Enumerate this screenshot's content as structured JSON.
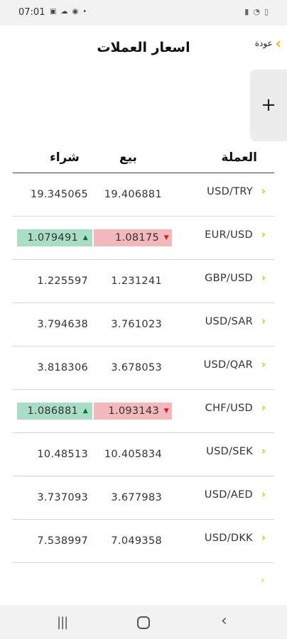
{
  "status_bar": {
    "time": "07:01",
    "left_icons": [
      "gallery-icon",
      "cloud-icon",
      "messenger-icon",
      "dot-icon"
    ],
    "right_icons": [
      "battery-saver-icon",
      "wifi-icon",
      "battery-icon"
    ]
  },
  "header": {
    "title": "اسعار العملات",
    "back_label": "عودة",
    "back_icon": "chevron-left-icon",
    "add_label": "+"
  },
  "table": {
    "columns": {
      "currency": "العملة",
      "sell": "بيع",
      "buy": "شراء"
    },
    "rows": [
      {
        "pair": "USD/TRY",
        "sell": "19.406881",
        "buy": "19.345065",
        "sell_trend": "",
        "buy_trend": ""
      },
      {
        "pair": "EUR/USD",
        "sell": "1.08175",
        "buy": "1.079491",
        "sell_trend": "down",
        "buy_trend": "up"
      },
      {
        "pair": "GBP/USD",
        "sell": "1.231241",
        "buy": "1.225597",
        "sell_trend": "",
        "buy_trend": ""
      },
      {
        "pair": "USD/SAR",
        "sell": "3.761023",
        "buy": "3.794638",
        "sell_trend": "",
        "buy_trend": ""
      },
      {
        "pair": "USD/QAR",
        "sell": "3.678053",
        "buy": "3.818306",
        "sell_trend": "",
        "buy_trend": ""
      },
      {
        "pair": "CHF/USD",
        "sell": "1.093143",
        "buy": "1.086881",
        "sell_trend": "down",
        "buy_trend": "up"
      },
      {
        "pair": "USD/SEK",
        "sell": "10.405834",
        "buy": "10.48513",
        "sell_trend": "",
        "buy_trend": ""
      },
      {
        "pair": "USD/AED",
        "sell": "3.677983",
        "buy": "3.737093",
        "sell_trend": "",
        "buy_trend": ""
      },
      {
        "pair": "USD/DKK",
        "sell": "7.049358",
        "buy": "7.538997",
        "sell_trend": "",
        "buy_trend": ""
      }
    ]
  },
  "colors": {
    "accent": "#d9c30f",
    "up_bg": "#a9ddc6",
    "down_bg": "#f2b8bb"
  },
  "nav_bar": {
    "icons": [
      "recents-icon",
      "home-icon",
      "back-icon"
    ]
  }
}
